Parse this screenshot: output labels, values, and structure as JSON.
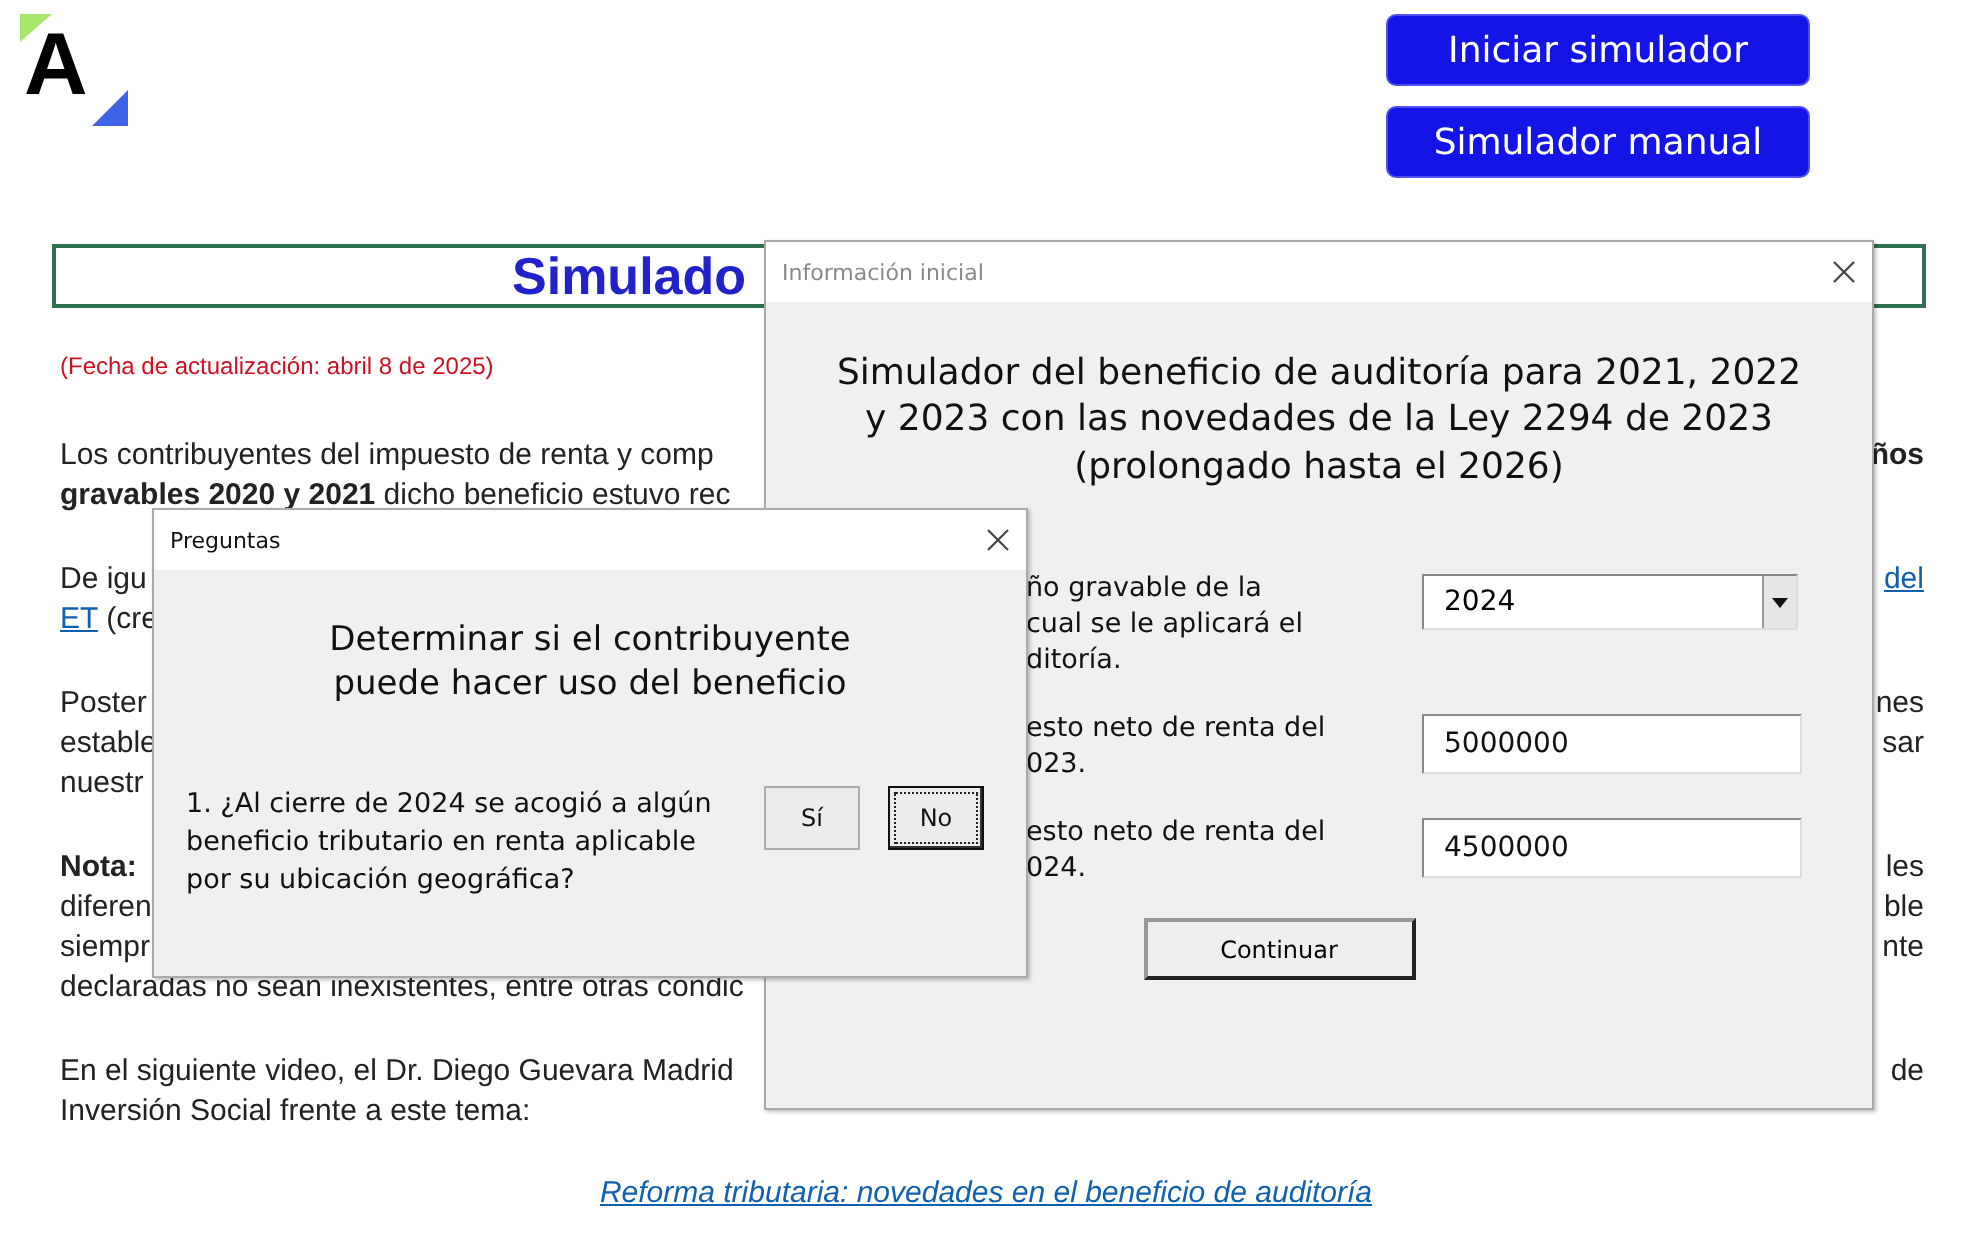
{
  "logo": {
    "text": "A"
  },
  "header_buttons": [
    "Iniciar simulador",
    "Simulador manual"
  ],
  "title": "Simulado",
  "update_date": "(Fecha de actualización: abril 8 de 2025)",
  "paragraphs": [
    {
      "lines": [
        {
          "left": [
            {
              "kind": "plain",
              "text": "Los contribuyentes del impuesto de renta y comp"
            }
          ],
          "right": [
            {
              "kind": "bold",
              "text": "ños"
            }
          ]
        },
        {
          "left": [
            {
              "kind": "bold",
              "text": "gravables 2020 y 2021"
            },
            {
              "kind": "plain",
              "text": " dicho beneficio estuvo rec"
            }
          ]
        }
      ]
    },
    {
      "lines": [
        {
          "left": [
            {
              "kind": "plain",
              "text": "De igu"
            }
          ],
          "right": [
            {
              "kind": "link",
              "text": "del"
            }
          ]
        },
        {
          "left": [
            {
              "kind": "link",
              "text": "ET"
            },
            {
              "kind": "plain",
              "text": " (cre"
            }
          ]
        }
      ]
    },
    {
      "lines": [
        {
          "left": [
            {
              "kind": "plain",
              "text": "Poster"
            }
          ],
          "right": [
            {
              "kind": "plain",
              "text": "nes"
            }
          ]
        },
        {
          "left": [
            {
              "kind": "plain",
              "text": "estable"
            }
          ],
          "right": [
            {
              "kind": "plain",
              "text": "sar"
            }
          ]
        },
        {
          "left": [
            {
              "kind": "plain",
              "text": "nuestr"
            }
          ]
        }
      ]
    },
    {
      "lines": [
        {
          "left": [
            {
              "kind": "bold",
              "text": "Nota:"
            }
          ],
          "right": [
            {
              "kind": "plain",
              "text": "les"
            }
          ]
        },
        {
          "left": [
            {
              "kind": "plain",
              "text": "diferen"
            }
          ],
          "right": [
            {
              "kind": "plain",
              "text": "ble"
            }
          ]
        },
        {
          "left": [
            {
              "kind": "plain",
              "text": "siempr"
            }
          ],
          "right": [
            {
              "kind": "plain",
              "text": "nte"
            }
          ]
        },
        {
          "left": [
            {
              "kind": "plain",
              "text": "declaradas no sean inexistentes, entre otras condic"
            }
          ]
        }
      ]
    },
    {
      "lines": [
        {
          "left": [
            {
              "kind": "plain",
              "text": "En el siguiente video, el Dr. Diego Guevara Madrid"
            }
          ],
          "right": [
            {
              "kind": "plain",
              "text": "de"
            }
          ]
        },
        {
          "left": [
            {
              "kind": "plain",
              "text": "Inversión Social frente a este tema:"
            }
          ]
        }
      ]
    }
  ],
  "video_link": "Reforma tributaria: novedades en el beneficio de auditoría",
  "info_dialog": {
    "title": "Información inicial",
    "heading": [
      "Simulador del beneficio de auditoría para 2021, 2022",
      "y 2023 con las novedades de la Ley 2294 de 2023",
      "(prolongado hasta el 2026)"
    ],
    "rows": [
      {
        "kind": "select",
        "label_lines": [
          "ño gravable de la",
          "cual se le aplicará el",
          "ditoría."
        ],
        "value": "2024"
      },
      {
        "kind": "input",
        "label_lines": [
          "esto neto de renta del",
          "023."
        ],
        "value": "5000000"
      },
      {
        "kind": "input",
        "label_lines": [
          "esto neto de renta del",
          "024."
        ],
        "value": "4500000"
      }
    ],
    "button": "Continuar"
  },
  "questions_dialog": {
    "title": "Preguntas",
    "heading": [
      "Determinar si el contribuyente",
      "puede hacer uso del beneficio"
    ],
    "question": "1. ¿Al cierre de 2024 se acogió a algún beneficio tributario en renta aplicable por su ubicación geográfica?",
    "buttons": [
      {
        "label": "Sí",
        "focused": false
      },
      {
        "label": "No",
        "focused": true
      }
    ]
  }
}
